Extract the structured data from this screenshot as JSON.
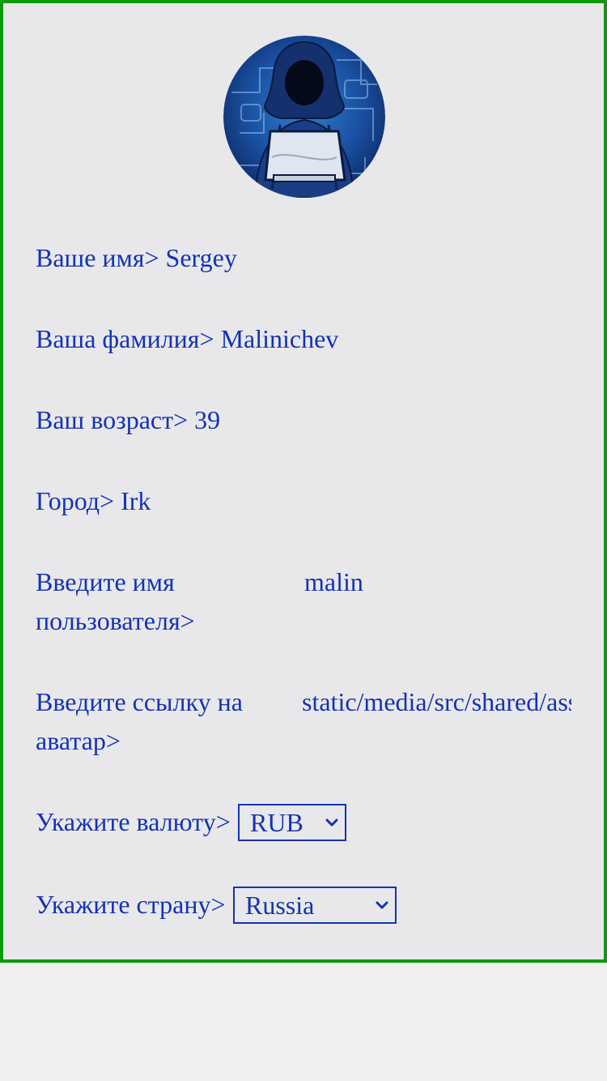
{
  "profile": {
    "avatar_description": "hacker-avatar",
    "first_name_label": "Ваше имя>",
    "first_name_value": "Sergey",
    "last_name_label": "Ваша фамилия>",
    "last_name_value": "Malinichev",
    "age_label": "Ваш возраст>",
    "age_value": "39",
    "city_label": "Город>",
    "city_value": "Irk",
    "username_label": "Введите имя пользователя>",
    "username_value": "malin",
    "avatar_link_label": "Введите ссылку на аватар>",
    "avatar_link_value": "static/media/src/shared/assets",
    "currency_label": "Укажите валюту>",
    "currency_value": "RUB",
    "country_label": "Укажите страну>",
    "country_value": "Russia"
  },
  "colors": {
    "text": "#1432b4",
    "border": "#0a9a0a",
    "background": "#e8e8ea"
  }
}
